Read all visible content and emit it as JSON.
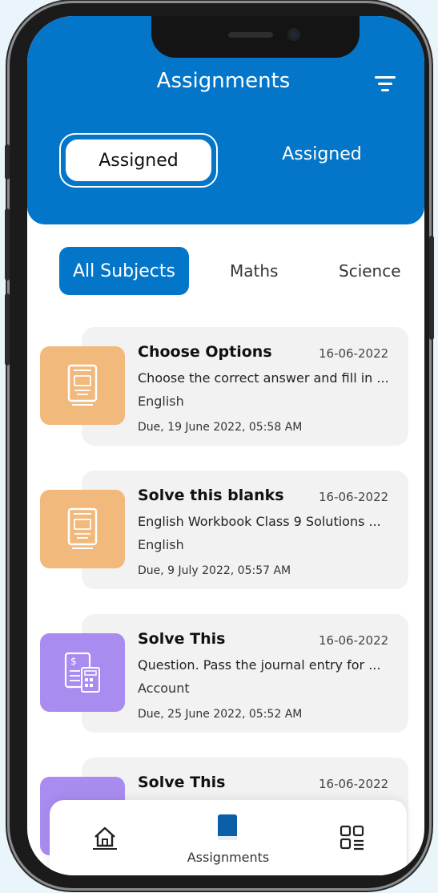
{
  "header": {
    "title": "Assignments",
    "filter_icon": "filter-icon",
    "tabs": [
      {
        "label": "Assigned",
        "active": true
      },
      {
        "label": "Assigned",
        "active": false
      }
    ]
  },
  "subjects": {
    "items": [
      {
        "label": "All Subjects",
        "active": true
      },
      {
        "label": "Maths",
        "active": false
      },
      {
        "label": "Science",
        "active": false
      }
    ]
  },
  "assignments": [
    {
      "title": "Choose Options",
      "date": "16-06-2022",
      "description": "Choose the correct answer and fill in ...",
      "subject": "English",
      "due": "Due, 19 June 2022, 05:58 AM",
      "icon": "english-book-icon",
      "color": "#f2b97c"
    },
    {
      "title": "Solve this blanks",
      "date": "16-06-2022",
      "description": "English Workbook Class 9 Solutions ...",
      "subject": "English",
      "due": "Due, 9 July 2022, 05:57 AM",
      "icon": "english-book-icon",
      "color": "#f2b97c"
    },
    {
      "title": "Solve This",
      "date": "16-06-2022",
      "description": "Question. Pass the journal entry for ...",
      "subject": "Account",
      "due": "Due, 25 June 2022, 05:52 AM",
      "icon": "accounting-calculator-icon",
      "color": "#a98cf0"
    },
    {
      "title": "Solve This",
      "date": "16-06-2022",
      "description": "",
      "subject": "",
      "due": "",
      "icon": "accounting-calculator-icon",
      "color": "#a98cf0"
    }
  ],
  "bottom_nav": {
    "home_icon": "home-icon",
    "assignments_label": "Assignments",
    "assignments_icon": "book-icon",
    "menu_icon": "grid-menu-icon"
  },
  "colors": {
    "primary": "#0476c9",
    "card_bg": "#f2f2f2"
  }
}
